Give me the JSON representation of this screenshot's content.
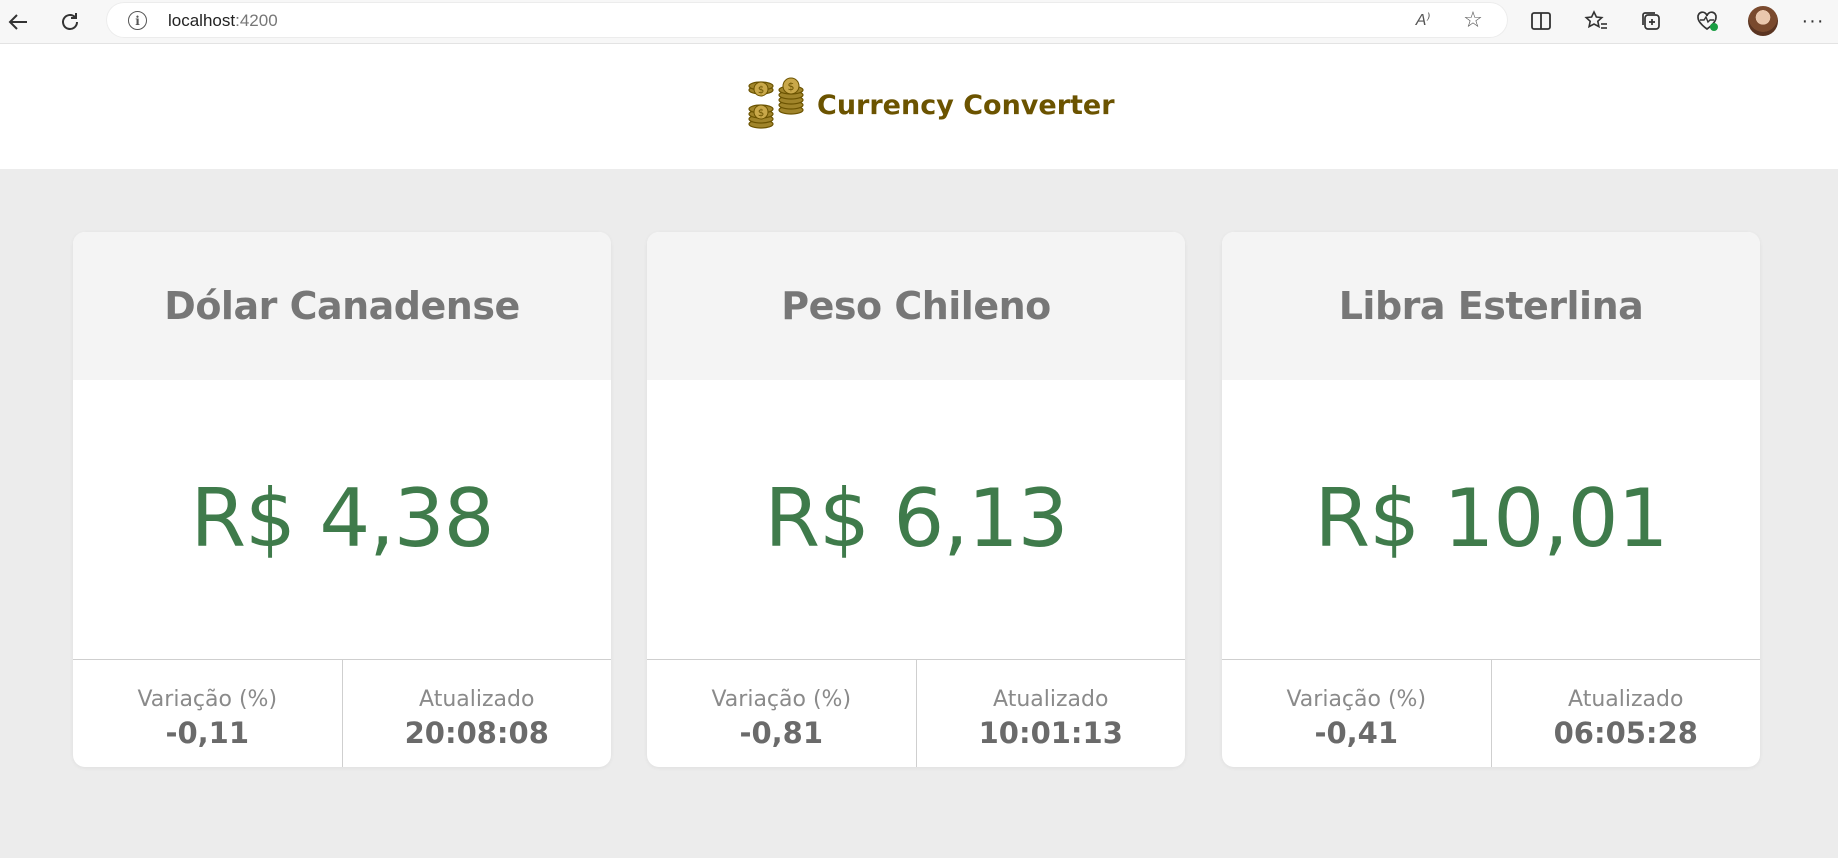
{
  "browser": {
    "url_host": "localhost",
    "url_port": ":4200",
    "icons": {
      "back": "arrow-left-icon",
      "reload": "reload-icon",
      "info": "info-icon",
      "read_aloud": "read-aloud-icon",
      "favorite": "star-icon",
      "split": "split-screen-icon",
      "favorites": "favorites-icon",
      "collections": "collections-icon",
      "health": "browser-essentials-icon",
      "more": "more-icon"
    }
  },
  "header": {
    "title": "Currency Converter",
    "logo_icon": "coins-icon",
    "title_color": "#6b5300"
  },
  "colors": {
    "value": "#3f7b4b",
    "background": "#ececec"
  },
  "cards": [
    {
      "name": "Dólar Canadense",
      "value": "R$ 4,38",
      "variation_label": "Variação (%)",
      "variation": "-0,11",
      "updated_label": "Atualizado",
      "updated": "20:08:08"
    },
    {
      "name": "Peso Chileno",
      "value": "R$ 6,13",
      "variation_label": "Variação (%)",
      "variation": "-0,81",
      "updated_label": "Atualizado",
      "updated": "10:01:13"
    },
    {
      "name": "Libra Esterlina",
      "value": "R$ 10,01",
      "variation_label": "Variação (%)",
      "variation": "-0,41",
      "updated_label": "Atualizado",
      "updated": "06:05:28"
    }
  ]
}
